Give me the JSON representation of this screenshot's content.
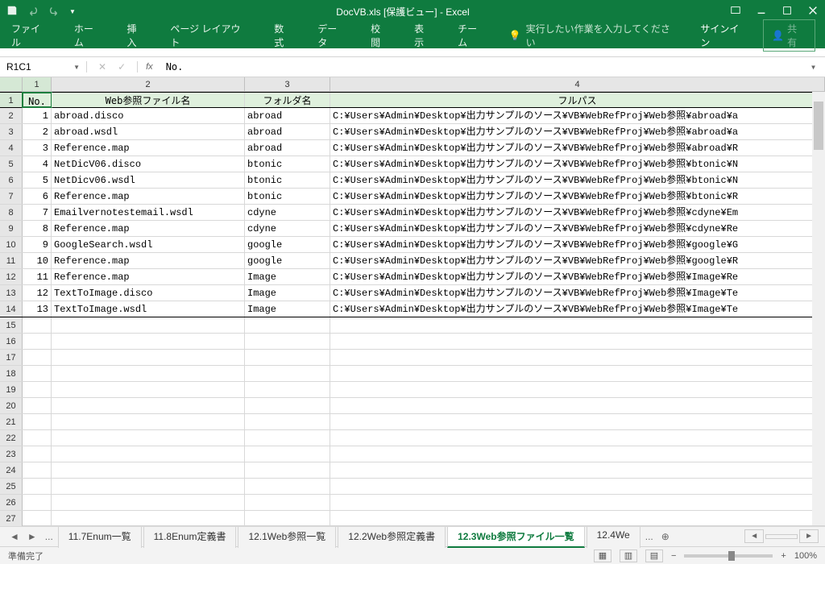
{
  "titlebar": {
    "title": "DocVB.xls [保護ビュー] - Excel"
  },
  "ribbon": {
    "tabs": [
      "ファイル",
      "ホーム",
      "挿入",
      "ページ レイアウト",
      "数式",
      "データ",
      "校閲",
      "表示",
      "チーム"
    ],
    "tell": "実行したい作業を入力してください",
    "signin": "サインイン",
    "share": "共有"
  },
  "fx": {
    "name": "R1C1",
    "formula": "No."
  },
  "columns": {
    "c1": "1",
    "c2": "2",
    "c3": "3",
    "c4": "4"
  },
  "headers": {
    "no": "No.",
    "file": "Web参照ファイル名",
    "folder": "フォルダ名",
    "path": "フルパス"
  },
  "rows": [
    {
      "n": "1",
      "file": "abroad.disco",
      "folder": "abroad",
      "path": "C:¥Users¥Admin¥Desktop¥出力サンプルのソース¥VB¥WebRefProj¥Web参照¥abroad¥a"
    },
    {
      "n": "2",
      "file": "abroad.wsdl",
      "folder": "abroad",
      "path": "C:¥Users¥Admin¥Desktop¥出力サンプルのソース¥VB¥WebRefProj¥Web参照¥abroad¥a"
    },
    {
      "n": "3",
      "file": "Reference.map",
      "folder": "abroad",
      "path": "C:¥Users¥Admin¥Desktop¥出力サンプルのソース¥VB¥WebRefProj¥Web参照¥abroad¥R"
    },
    {
      "n": "4",
      "file": "NetDicV06.disco",
      "folder": "btonic",
      "path": "C:¥Users¥Admin¥Desktop¥出力サンプルのソース¥VB¥WebRefProj¥Web参照¥btonic¥N"
    },
    {
      "n": "5",
      "file": "NetDicv06.wsdl",
      "folder": "btonic",
      "path": "C:¥Users¥Admin¥Desktop¥出力サンプルのソース¥VB¥WebRefProj¥Web参照¥btonic¥N"
    },
    {
      "n": "6",
      "file": "Reference.map",
      "folder": "btonic",
      "path": "C:¥Users¥Admin¥Desktop¥出力サンプルのソース¥VB¥WebRefProj¥Web参照¥btonic¥R"
    },
    {
      "n": "7",
      "file": "Emailvernotestemail.wsdl",
      "folder": "cdyne",
      "path": "C:¥Users¥Admin¥Desktop¥出力サンプルのソース¥VB¥WebRefProj¥Web参照¥cdyne¥Em"
    },
    {
      "n": "8",
      "file": "Reference.map",
      "folder": "cdyne",
      "path": "C:¥Users¥Admin¥Desktop¥出力サンプルのソース¥VB¥WebRefProj¥Web参照¥cdyne¥Re"
    },
    {
      "n": "9",
      "file": "GoogleSearch.wsdl",
      "folder": "google",
      "path": "C:¥Users¥Admin¥Desktop¥出力サンプルのソース¥VB¥WebRefProj¥Web参照¥google¥G"
    },
    {
      "n": "10",
      "file": "Reference.map",
      "folder": "google",
      "path": "C:¥Users¥Admin¥Desktop¥出力サンプルのソース¥VB¥WebRefProj¥Web参照¥google¥R"
    },
    {
      "n": "11",
      "file": "Reference.map",
      "folder": "Image",
      "path": "C:¥Users¥Admin¥Desktop¥出力サンプルのソース¥VB¥WebRefProj¥Web参照¥Image¥Re"
    },
    {
      "n": "12",
      "file": "TextToImage.disco",
      "folder": "Image",
      "path": "C:¥Users¥Admin¥Desktop¥出力サンプルのソース¥VB¥WebRefProj¥Web参照¥Image¥Te"
    },
    {
      "n": "13",
      "file": "TextToImage.wsdl",
      "folder": "Image",
      "path": "C:¥Users¥Admin¥Desktop¥出力サンプルのソース¥VB¥WebRefProj¥Web参照¥Image¥Te"
    }
  ],
  "emptyRows": 13,
  "sheets": {
    "ellipsis": "...",
    "tabs": [
      "11.7Enum一覧",
      "11.8Enum定義書",
      "12.1Web参照一覧",
      "12.2Web参照定義書",
      "12.3Web参照ファイル一覧",
      "12.4We"
    ],
    "activeIndex": 4,
    "trailEllipsis": "..."
  },
  "status": {
    "ready": "準備完了",
    "zoom": "100%"
  }
}
